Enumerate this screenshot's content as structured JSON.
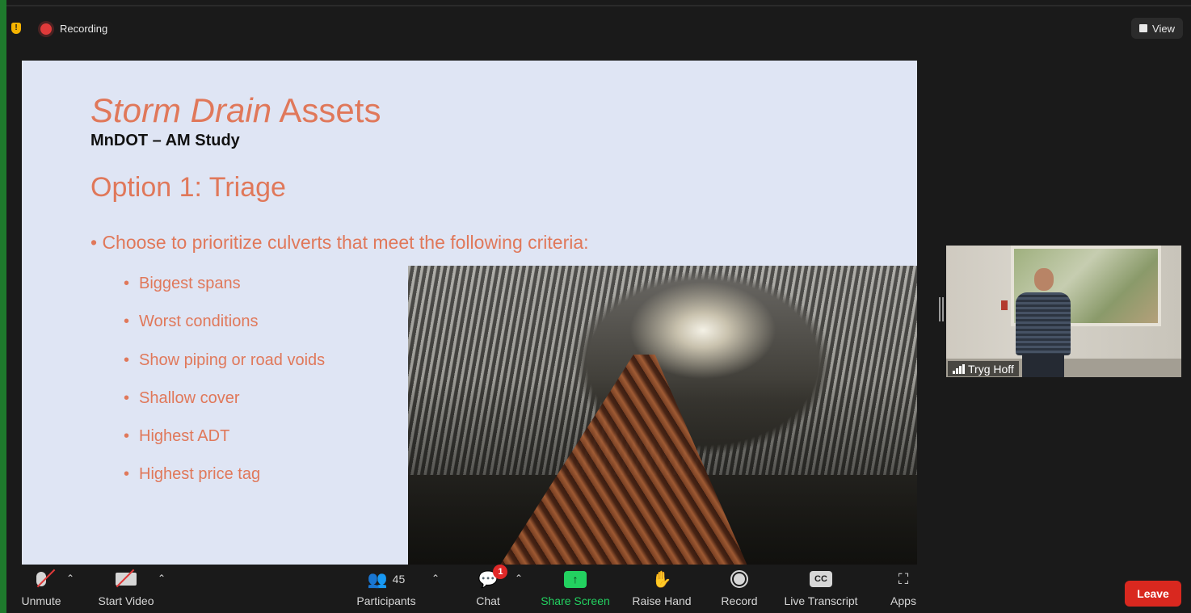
{
  "status": {
    "recording_label": "Recording",
    "view_label": "View"
  },
  "slide": {
    "title_italic": "Storm Drain",
    "title_rest": "Assets",
    "subtitle": "MnDOT – AM Study",
    "option": "Option 1:  Triage",
    "main_bullet": "• Choose to prioritize culverts that meet the following criteria:",
    "criteria": [
      "Biggest spans",
      "Worst conditions",
      "Show piping or road voids",
      "Shallow cover",
      "Highest ADT",
      "Highest price tag"
    ]
  },
  "participant": {
    "name": "Tryg Hoff"
  },
  "toolbar": {
    "unmute": "Unmute",
    "start_video": "Start Video",
    "participants": "Participants",
    "participants_count": "45",
    "chat": "Chat",
    "chat_badge": "1",
    "share_screen": "Share Screen",
    "raise_hand": "Raise Hand",
    "record": "Record",
    "live_transcript": "Live Transcript",
    "cc": "CC",
    "apps": "Apps",
    "leave": "Leave"
  },
  "colors": {
    "accent_orange": "#e0785a",
    "share_green": "#23d160",
    "leave_red": "#d9281f",
    "recording_red": "#e03a3a"
  }
}
